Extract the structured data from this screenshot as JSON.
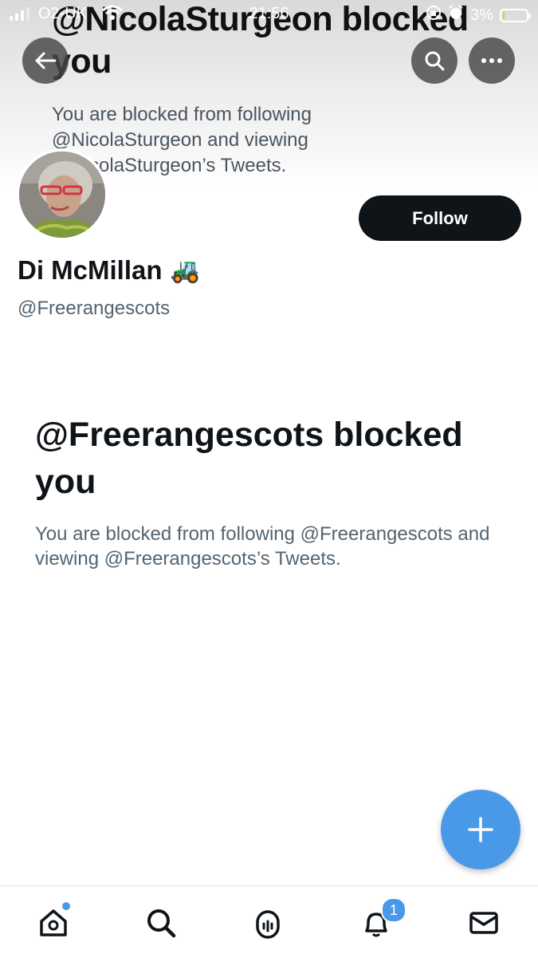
{
  "status_bar": {
    "carrier": "O2-UK",
    "time": "21:56",
    "battery": "3%",
    "battery_level": 0.03
  },
  "banner": {
    "title": "@NicolaSturgeon blocked you",
    "text": "You are blocked from following @NicolaSturgeon and viewing @NicolaSturgeon’s Tweets."
  },
  "profile": {
    "name": "Di McMillan",
    "name_emoji": "🚜",
    "handle": "@Freerangescots",
    "follow_label": "Follow"
  },
  "blocked": {
    "title": "@Freerangescots blocked you",
    "text": "You are blocked from following @Freerangescots and viewing @Freerangescots’s Tweets."
  },
  "tabs": {
    "notifications_badge": "1"
  },
  "icons": {
    "back": "back-arrow-icon",
    "search": "search-icon",
    "more": "more-icon",
    "compose": "plus-icon",
    "home": "home-icon",
    "explore": "search-icon",
    "spaces": "spaces-icon",
    "notifications": "bell-icon",
    "messages": "mail-icon"
  },
  "colors": {
    "accent": "#4a99e9",
    "text_primary": "#0f1419",
    "text_secondary": "#536471",
    "button_dark": "#0f1419"
  }
}
